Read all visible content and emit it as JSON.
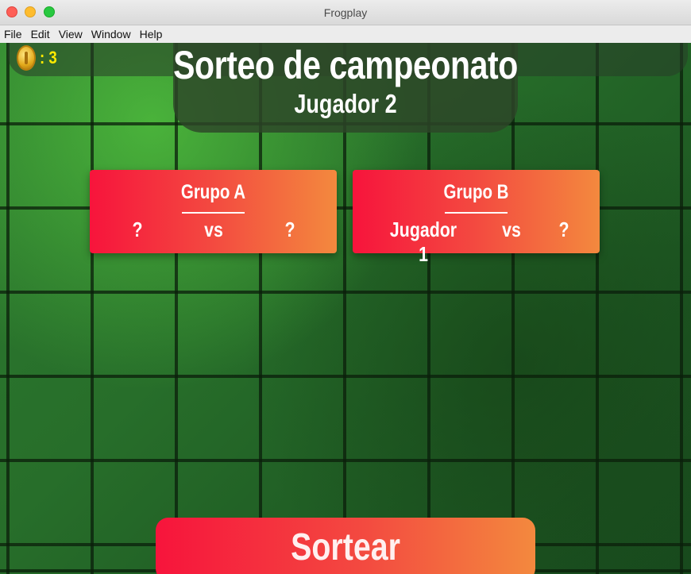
{
  "window": {
    "title": "Frogplay"
  },
  "menu": [
    "File",
    "Edit",
    "View",
    "Window",
    "Help"
  ],
  "hud": {
    "coin_icon": "coin-icon",
    "coin_count": ": 3"
  },
  "header": {
    "title": "Sorteo de campeonato",
    "subtitle": "Jugador 2"
  },
  "groups": [
    {
      "name": "Grupo A",
      "player1": "?",
      "vs": "vs",
      "player2": "?"
    },
    {
      "name": "Grupo B",
      "player1": "Jugador 1",
      "vs": "vs",
      "player2": "?"
    }
  ],
  "actions": {
    "draw_label": "Sortear"
  },
  "colors": {
    "card_gradient_start": "#f7143c",
    "card_gradient_end": "#f3893e",
    "coin_text": "#ffea00",
    "background": "#1f5c24"
  }
}
